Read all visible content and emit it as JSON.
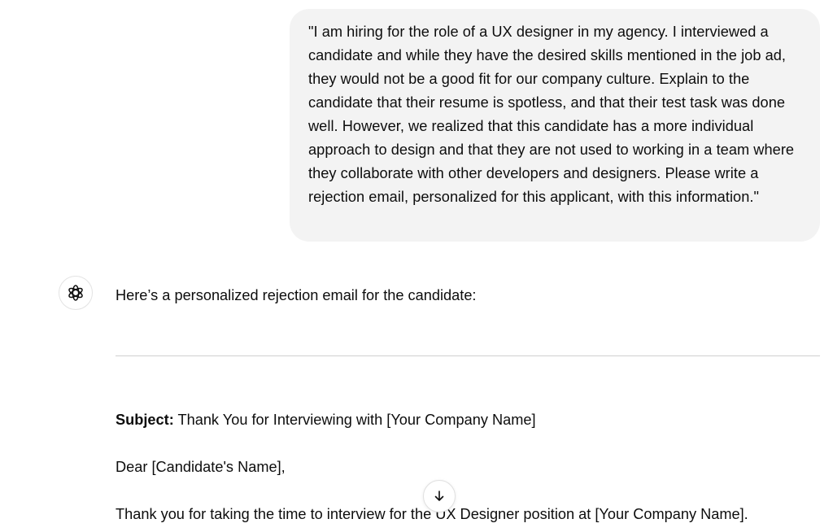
{
  "conversation": {
    "user_message": {
      "text": "\"I am hiring for the role of a UX designer in my agency. I interviewed a candidate and while they have the desired skills mentioned in the job ad, they would not be a good fit for our company culture. Explain to the candidate that their resume is spotless, and that their test task was done well. However, we realized that this candidate has a more individual approach to design and that they are not used to working in a team where they collaborate with other developers and designers. Please write a rejection email, personalized for this applicant, with this information.\""
    },
    "assistant_message": {
      "avatar_icon": "chatgpt-logo-icon",
      "intro": "Here’s a personalized rejection email for the candidate:",
      "email": {
        "subject_label": "Subject:",
        "subject_text": " Thank You for Interviewing with [Your Company Name]",
        "greeting": "Dear [Candidate's Name],",
        "first_line": "Thank you for taking the time to interview for the UX Designer position at [Your Company Name]."
      }
    }
  },
  "controls": {
    "scroll_down_icon": "arrow-down-icon"
  },
  "colors": {
    "user_bubble_bg": "#f3f3f3",
    "text": "#0d0d0d",
    "divider": "#d0d0d0"
  }
}
